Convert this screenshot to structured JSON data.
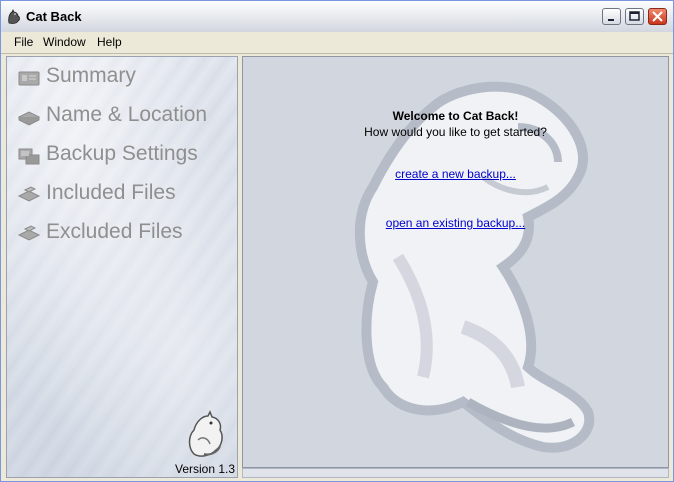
{
  "window": {
    "title": "Cat Back"
  },
  "menu": {
    "items": [
      "File",
      "Window",
      "Help"
    ]
  },
  "sidebar": {
    "items": [
      {
        "label": "Summary",
        "icon": "summary-icon"
      },
      {
        "label": "Name & Location",
        "icon": "name-location-icon"
      },
      {
        "label": "Backup Settings",
        "icon": "backup-settings-icon"
      },
      {
        "label": "Included Files",
        "icon": "included-files-icon"
      },
      {
        "label": "Excluded Files",
        "icon": "excluded-files-icon"
      }
    ],
    "version": "Version 1.3"
  },
  "main": {
    "welcome_title": "Welcome to Cat Back!",
    "welcome_subtitle": "How would you like to get started?",
    "create_link": "create a new backup...",
    "open_link": "open an existing backup..."
  },
  "colors": {
    "link": "#0000cc",
    "nav_text": "#8f8f8f",
    "panel_bg": "#d2d6de"
  }
}
